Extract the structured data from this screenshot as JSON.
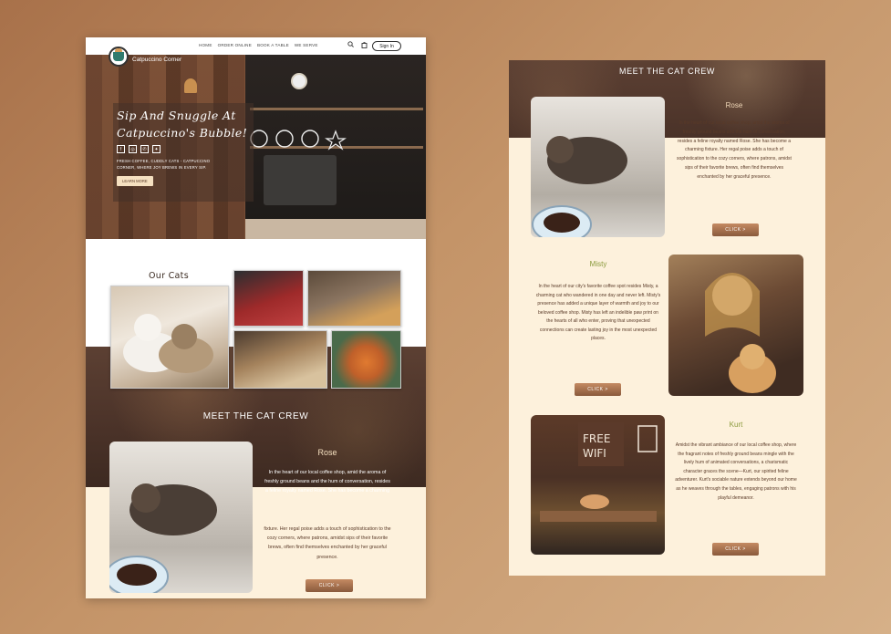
{
  "left_page": {
    "brand": "Catpuccino Corner",
    "nav": {
      "links": [
        "HOME",
        "ORDER ONLINE",
        "BOOK A TABLE",
        "WE SERVE"
      ],
      "signin": "Sign In"
    },
    "hero": {
      "title_line1": "Sip And Snuggle At",
      "title_line2": "Catpuccino's Bubble!",
      "text": "FRESH COFFEE, CUDDLY CATS - CATPUCCINO CORNER, WHERE JOY BREWS IN EVERY SIP.",
      "button": "LEARN MORE"
    },
    "our_cats_title": "Our Cats",
    "meet_title": "MEET THE CAT CREW",
    "rose": {
      "name": "Rose",
      "text_upper": "In the heart of our local coffee shop, amid the aroma of freshly ground beans and the hum of conversation, resides a feline royalty named Rose. She has become a charming",
      "text_lower": "fixture. Her regal poise adds a touch of sophistication to the cozy corners, where patrons, amidst sips of their favorite brews, often find themselves enchanted by her graceful presence.",
      "button": "CLICK >"
    }
  },
  "right_page": {
    "meet_title": "MEET THE CAT CREW",
    "rose": {
      "name": "Rose",
      "text": "In the heart of our local coffee shop, amid the aroma of freshly ground beans and the hum of conversation, resides a feline royalty named Rose. She has become a charming fixture. Her regal poise adds a touch of sophistication to the cozy corners, where patrons, amidst sips of their favorite brews, often find themselves enchanted by her graceful presence.",
      "button": "CLICK >"
    },
    "misty": {
      "name": "Misty",
      "text": "In the heart of our city's favorite coffee spot resides Misty, a charming cat who wandered in one day and never left. Misty's presence has added a unique layer of warmth and joy to our beloved coffee shop. Misty has left an indelible paw print on the hearts of all who enter, proving that unexpected connections can create lasting joy in the most unexpected places.",
      "button": "CLICK >"
    },
    "kurt": {
      "name": "Kurt",
      "text": "Amidst the vibrant ambiance of our local coffee shop, where the fragrant notes of freshly ground beans mingle with the lively hum of animated conversations, a charismatic character graces the scene—Kurt, our spirited feline adventurer. Kurt's sociable nature extends beyond our home as he weaves through the tables, engaging patrons with his playful demeanor.",
      "button": "CLICK >",
      "wifi_sign": "FREE WIFI"
    }
  },
  "colors": {
    "background_start": "#a8714a",
    "background_end": "#d6b088",
    "cream": "#fdf1dc",
    "dark_brown": "#4a3228",
    "accent_button": "#a56e4a",
    "misty_kurt_heading": "#8a9a3c"
  },
  "icons": [
    "logo-cup-icon",
    "search-icon",
    "cart-icon",
    "facebook-icon",
    "instagram-icon",
    "whatsapp-icon",
    "twitter-icon",
    "chevron-right-icon"
  ]
}
